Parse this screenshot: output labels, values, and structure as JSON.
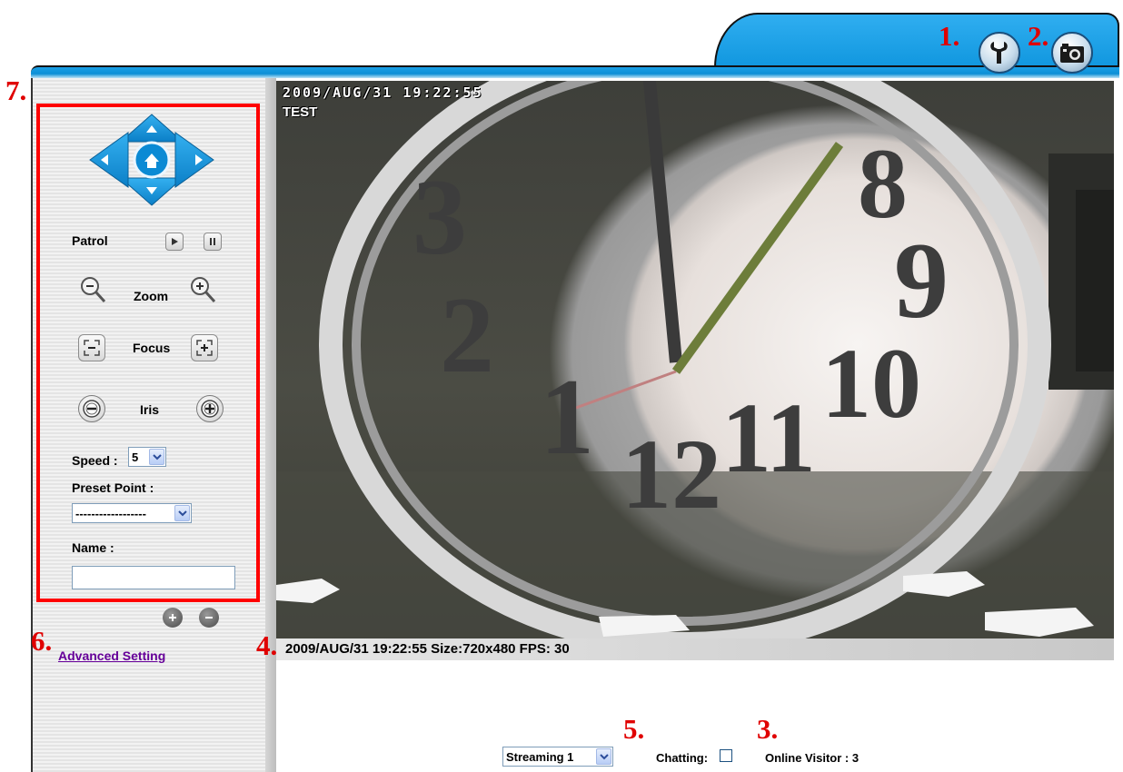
{
  "markers": {
    "m1": "1.",
    "m2": "2.",
    "m3": "3.",
    "m4": "4.",
    "m5": "5.",
    "m6": "6.",
    "m7": "7."
  },
  "header": {
    "settings_icon": "wrench-icon",
    "snapshot_icon": "camera-icon"
  },
  "video": {
    "osd_timestamp": "2009/AUG/31  19:22:55",
    "osd_title": "TEST",
    "status_text": "2009/AUG/31 19:22:55 Size:720x480 FPS: 30",
    "clock_numerals": [
      "8",
      "9",
      "10",
      "11",
      "12",
      "1",
      "2",
      "3"
    ]
  },
  "ptz": {
    "patrol_label": "Patrol",
    "zoom_label": "Zoom",
    "focus_label": "Focus",
    "iris_label": "Iris",
    "speed_label": "Speed :",
    "speed_value": "5",
    "preset_label": "Preset Point :",
    "preset_value": "------------------",
    "name_label": "Name :",
    "name_value": ""
  },
  "sidebar": {
    "advanced_setting_link": "Advanced Setting"
  },
  "bottom": {
    "stream_select": "Streaming 1",
    "chatting_label": "Chatting:",
    "chatting_checked": false,
    "online_visitor": "Online Visitor : 3"
  },
  "colors": {
    "accent_blue": "#0b93dc",
    "marker_red": "#e00000",
    "link_purple": "#660099",
    "highlight_box": "#ff0000"
  }
}
